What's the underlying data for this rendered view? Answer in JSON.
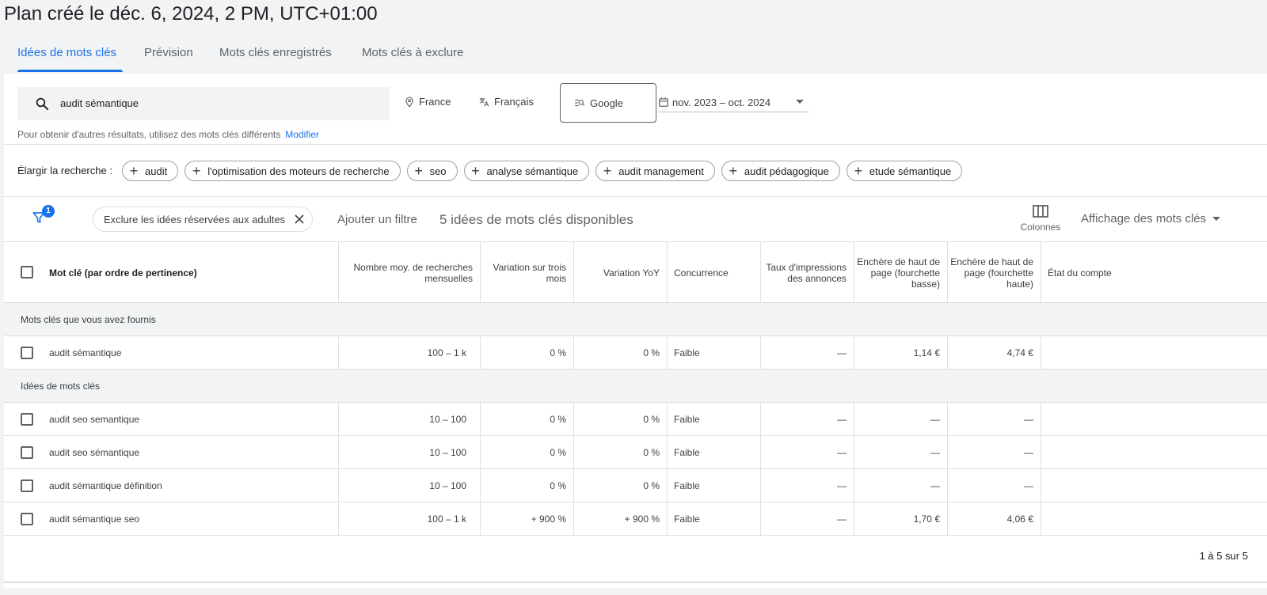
{
  "plan_title": "Plan créé le déc. 6, 2024, 2 PM, UTC+01:00",
  "tabs": [
    {
      "label": "Idées de mots clés",
      "active": true
    },
    {
      "label": "Prévision",
      "active": false
    },
    {
      "label": "Mots clés enregistrés",
      "active": false
    },
    {
      "label": "Mots clés à exclure",
      "active": false
    }
  ],
  "search": {
    "value": "audit sémantique",
    "location": "France",
    "language": "Français",
    "network": "Google",
    "date_range": "nov. 2023 – oct. 2024",
    "hint": "Pour obtenir d'autres résultats, utilisez des mots clés différents",
    "modify_link": "Modifier"
  },
  "broaden": {
    "label": "Élargir la recherche :",
    "chips": [
      "audit",
      "l'optimisation des moteurs de recherche",
      "seo",
      "analyse sémantique",
      "audit management",
      "audit pédagogique",
      "etude sémantique"
    ]
  },
  "filter_bar": {
    "badge_count": "1",
    "active_filter": "Exclure les idées réservées aux adultes",
    "add_filter": "Ajouter un filtre",
    "ideas_count": "5 idées de mots clés disponibles",
    "columns_label": "Colonnes",
    "view_label": "Affichage des mots clés"
  },
  "table": {
    "headers": {
      "keyword": "Mot clé (par ordre de pertinence)",
      "avg_searches": "Nombre moy. de recherches mensuelles",
      "three_month": "Variation sur trois mois",
      "yoy": "Variation YoY",
      "competition": "Concurrence",
      "impression_share": "Taux d'impressions des annonces",
      "bid_low": "Enchère de haut de page (fourchette basse)",
      "bid_high": "Enchère de haut de page (fourchette haute)",
      "account_status": "État du compte"
    },
    "provided_section": "Mots clés que vous avez fournis",
    "ideas_section": "Idées de mots clés",
    "provided_rows": [
      {
        "keyword": "audit sémantique",
        "avg": "100 – 1 k",
        "three_month": "0 %",
        "yoy": "0 %",
        "competition": "Faible",
        "impr": "—",
        "bid_low": "1,14 €",
        "bid_high": "4,74 €"
      }
    ],
    "idea_rows": [
      {
        "keyword": "audit seo semantique",
        "avg": "10 – 100",
        "three_month": "0 %",
        "yoy": "0 %",
        "competition": "Faible",
        "impr": "—",
        "bid_low": "—",
        "bid_high": "—"
      },
      {
        "keyword": "audit seo sémantique",
        "avg": "10 – 100",
        "three_month": "0 %",
        "yoy": "0 %",
        "competition": "Faible",
        "impr": "—",
        "bid_low": "—",
        "bid_high": "—"
      },
      {
        "keyword": "audit sémantique définition",
        "avg": "10 – 100",
        "three_month": "0 %",
        "yoy": "0 %",
        "competition": "Faible",
        "impr": "—",
        "bid_low": "—",
        "bid_high": "—"
      },
      {
        "keyword": "audit sémantique seo",
        "avg": "100 – 1 k",
        "three_month": "+ 900 %",
        "yoy": "+ 900 %",
        "competition": "Faible",
        "impr": "—",
        "bid_low": "1,70 €",
        "bid_high": "4,06 €"
      }
    ],
    "pagination": "1 à 5 sur 5"
  },
  "colors": {
    "accent": "#1a73e8",
    "text": "#202124",
    "muted": "#5f6368",
    "section_bg": "#f1f3f4"
  }
}
